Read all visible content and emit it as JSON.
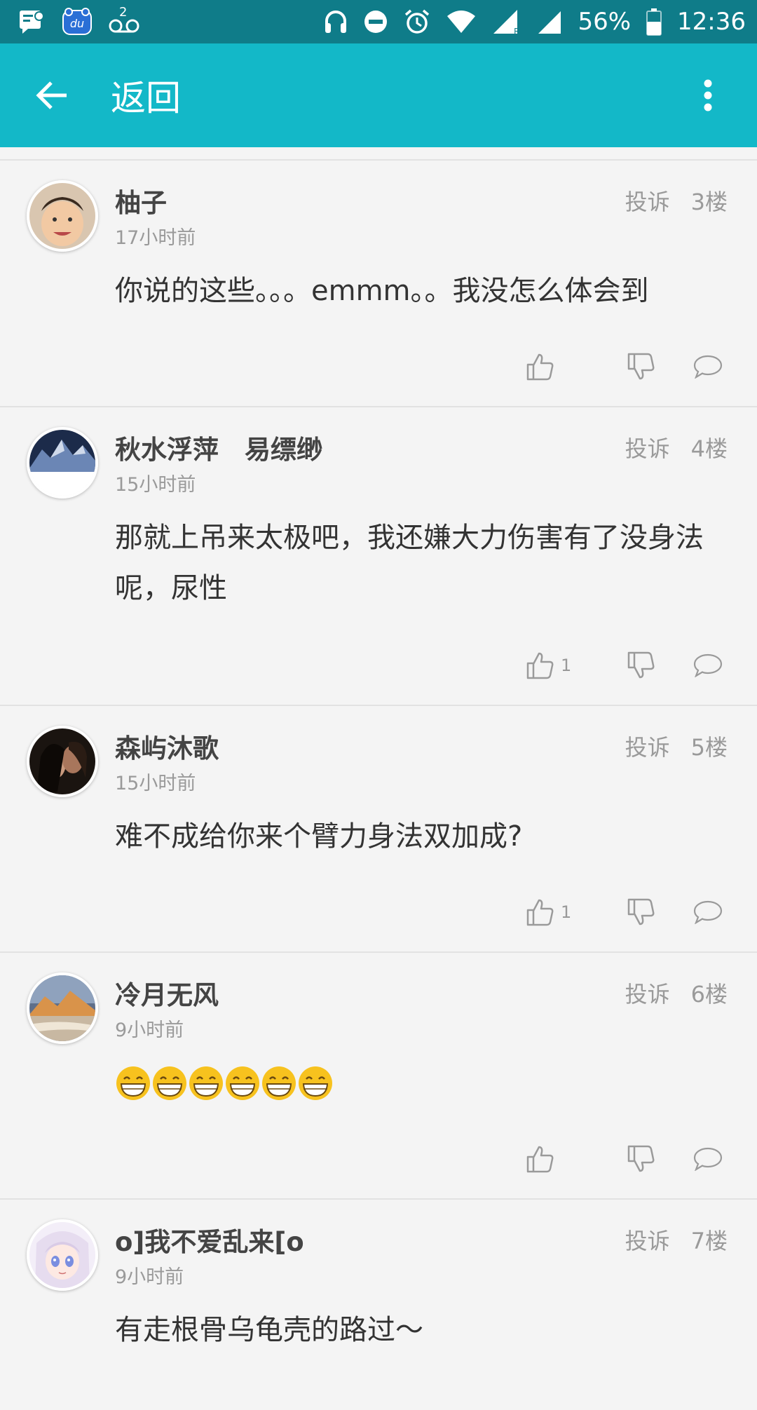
{
  "status_bar": {
    "battery": "56%",
    "time": "12:36",
    "sim_indicator": "2",
    "icons": [
      "notification-icon",
      "baidu-du-icon",
      "voicemail-icon",
      "headphones-icon",
      "do-not-disturb-icon",
      "alarm-icon",
      "wifi-icon",
      "signal-r-icon",
      "signal-icon",
      "battery-icon"
    ]
  },
  "app_bar": {
    "back_icon": "arrow-left-icon",
    "title": "返回",
    "menu_icon": "more-vertical-icon"
  },
  "colors": {
    "status_bar": "#0f7c89",
    "app_bar": "#13b8c8",
    "background": "#f4f4f4"
  },
  "labels": {
    "report": "投诉"
  },
  "comments": [
    {
      "username": "柚子",
      "time": "17小时前",
      "floor": "3楼",
      "content": "你说的这些。。。emmm。。我没怎么体会到",
      "likes": ""
    },
    {
      "username": "秋水浮萍　易缥缈",
      "time": "15小时前",
      "floor": "4楼",
      "content": "那就上吊来太极吧，我还嫌大力伤害有了没身法呢，尿性",
      "likes": "1"
    },
    {
      "username": "森屿沐歌",
      "time": "15小时前",
      "floor": "5楼",
      "content": "难不成给你来个臂力身法双加成?",
      "likes": "1"
    },
    {
      "username": "冷月无风",
      "time": "9小时前",
      "floor": "6楼",
      "content": "",
      "emoji_count": 6,
      "emoji_icon": "grinning-face-icon",
      "likes": ""
    },
    {
      "username": "o]我不爱乱来[o",
      "time": "9小时前",
      "floor": "7楼",
      "content": "有走根骨乌龟壳的路过～",
      "likes": ""
    }
  ]
}
